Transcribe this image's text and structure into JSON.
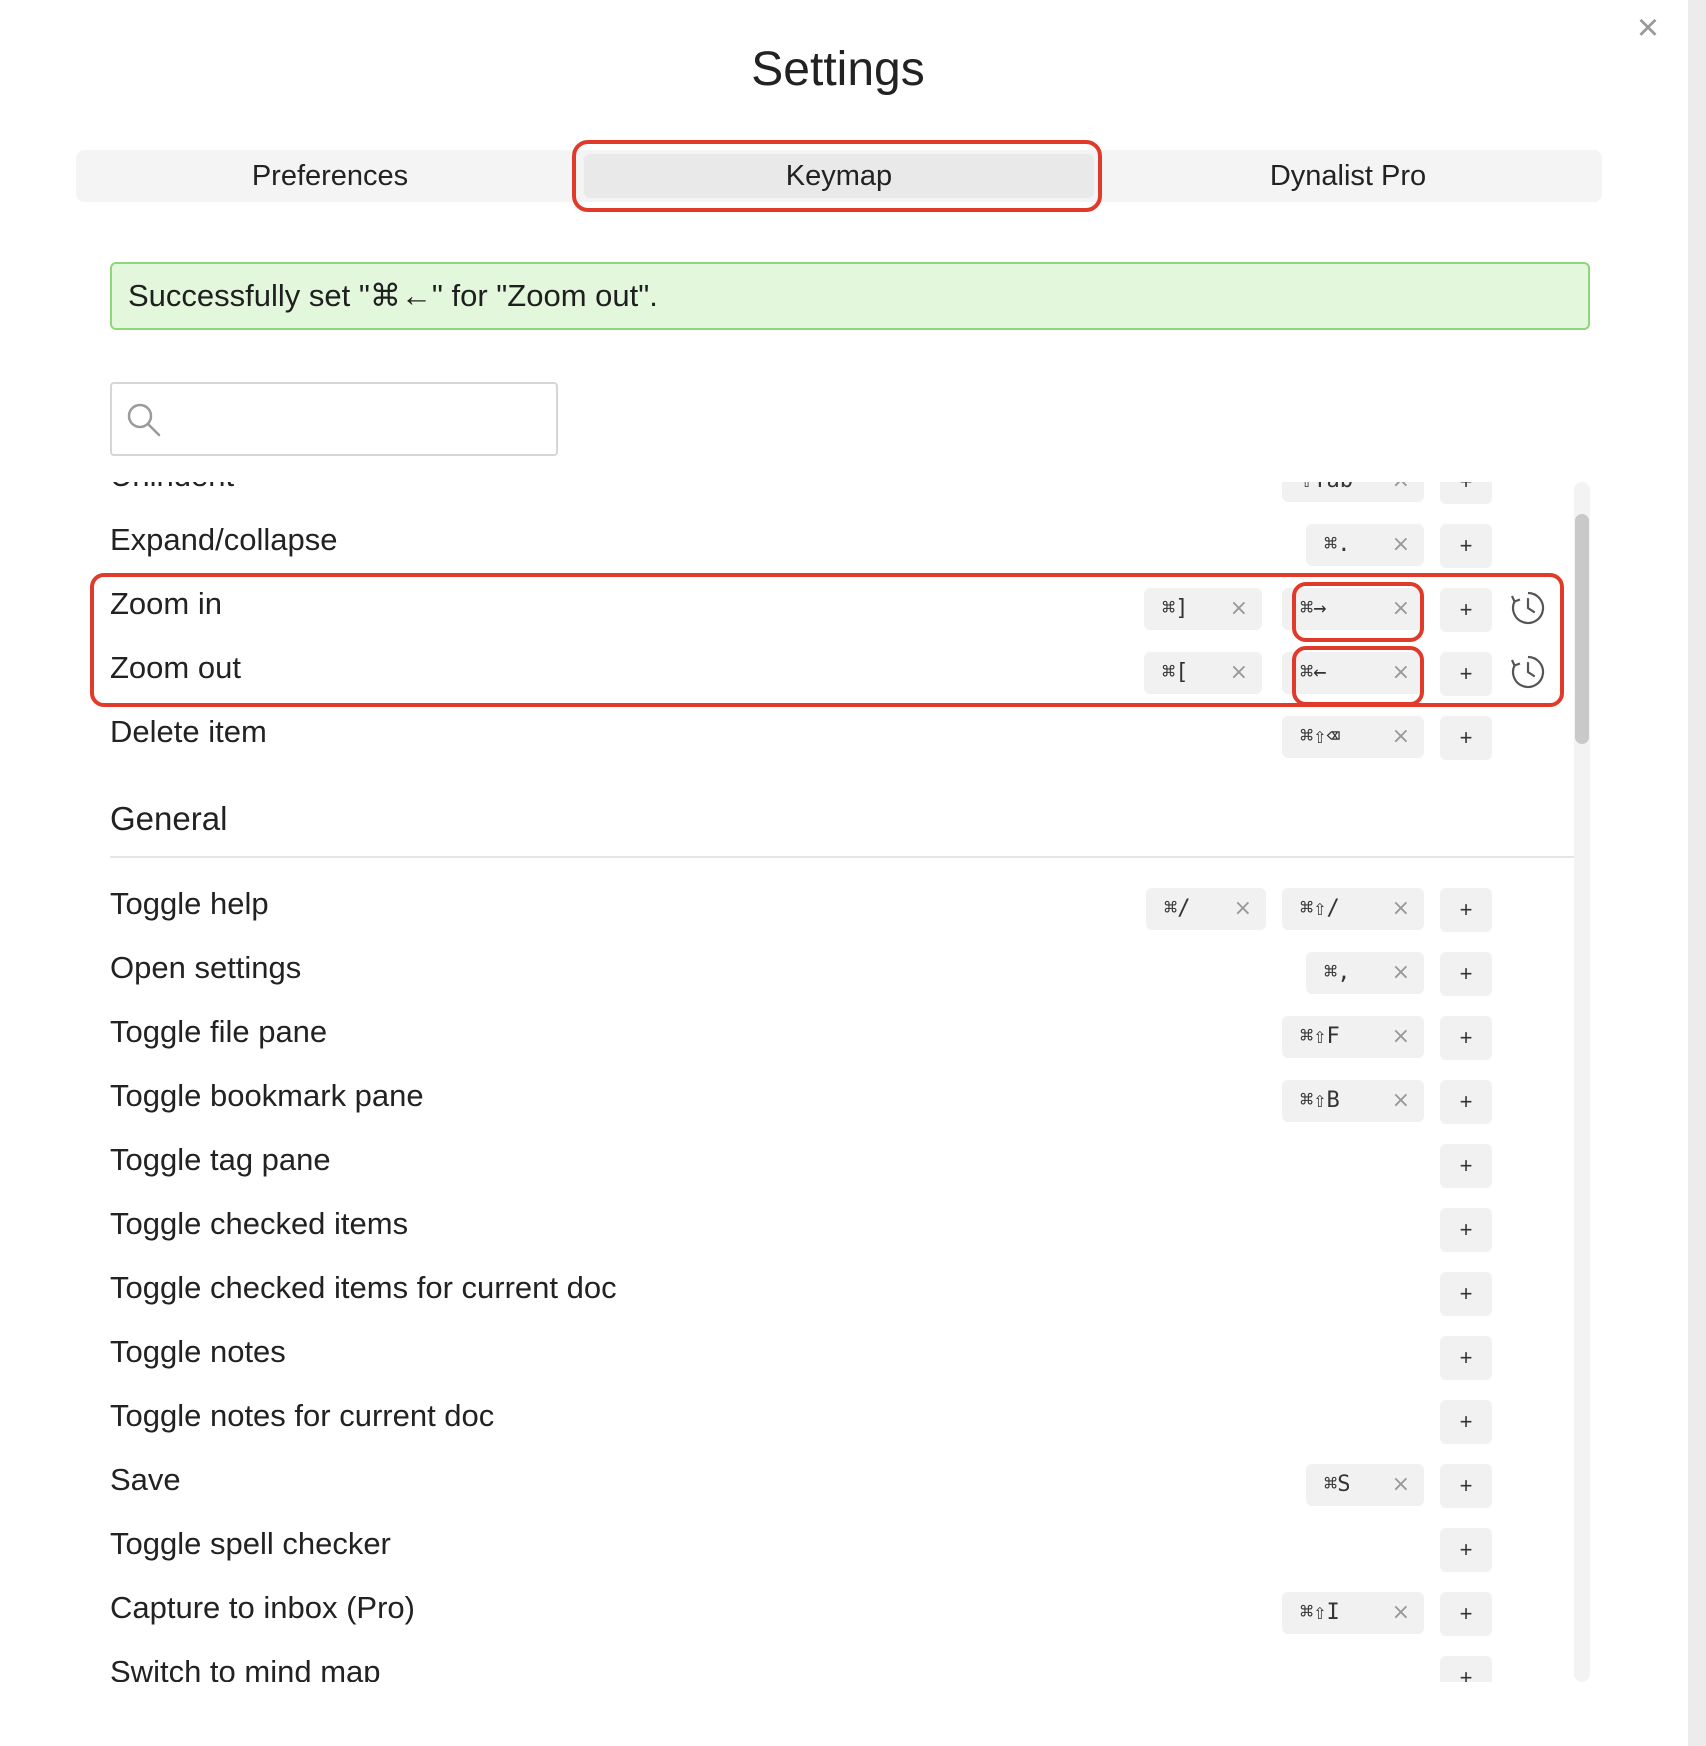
{
  "title": "Settings",
  "close_icon_glyph": "×",
  "tabs": [
    {
      "label": "Preferences"
    },
    {
      "label": "Keymap"
    },
    {
      "label": "Dynalist Pro"
    }
  ],
  "active_tab": "Keymap",
  "notice": "Successfully set \"⌘←\" for \"Zoom out\".",
  "search": {
    "placeholder": "",
    "value": ""
  },
  "colors": {
    "highlight": "#e03a2b",
    "notice_bg": "#e3f7dc",
    "notice_border": "#8fd67a"
  },
  "plus_glyph": "+",
  "remove_glyph": "×",
  "rows_top": [
    {
      "label": "Unindent",
      "keys": [
        "⇧Tab"
      ],
      "partial": true
    },
    {
      "label": "Expand/collapse",
      "keys": [
        "⌘."
      ]
    },
    {
      "label": "Zoom in",
      "keys": [
        "⌘]",
        "⌘→"
      ],
      "reset": true
    },
    {
      "label": "Zoom out",
      "keys": [
        "⌘[",
        "⌘←"
      ],
      "reset": true
    },
    {
      "label": "Delete item",
      "keys": [
        "⌘⇧⌫"
      ]
    }
  ],
  "section_general": "General",
  "rows_general": [
    {
      "label": "Toggle help",
      "keys": [
        "⌘/",
        "⌘⇧/"
      ]
    },
    {
      "label": "Open settings",
      "keys": [
        "⌘,"
      ]
    },
    {
      "label": "Toggle file pane",
      "keys": [
        "⌘⇧F"
      ]
    },
    {
      "label": "Toggle bookmark pane",
      "keys": [
        "⌘⇧B"
      ]
    },
    {
      "label": "Toggle tag pane",
      "keys": []
    },
    {
      "label": "Toggle checked items",
      "keys": []
    },
    {
      "label": "Toggle checked items for current doc",
      "keys": []
    },
    {
      "label": "Toggle notes",
      "keys": []
    },
    {
      "label": "Toggle notes for current doc",
      "keys": []
    },
    {
      "label": "Save",
      "keys": [
        "⌘S"
      ]
    },
    {
      "label": "Toggle spell checker",
      "keys": []
    },
    {
      "label": "Capture to inbox (Pro)",
      "keys": [
        "⌘⇧I"
      ]
    },
    {
      "label": "Switch to mind map",
      "keys": []
    }
  ]
}
